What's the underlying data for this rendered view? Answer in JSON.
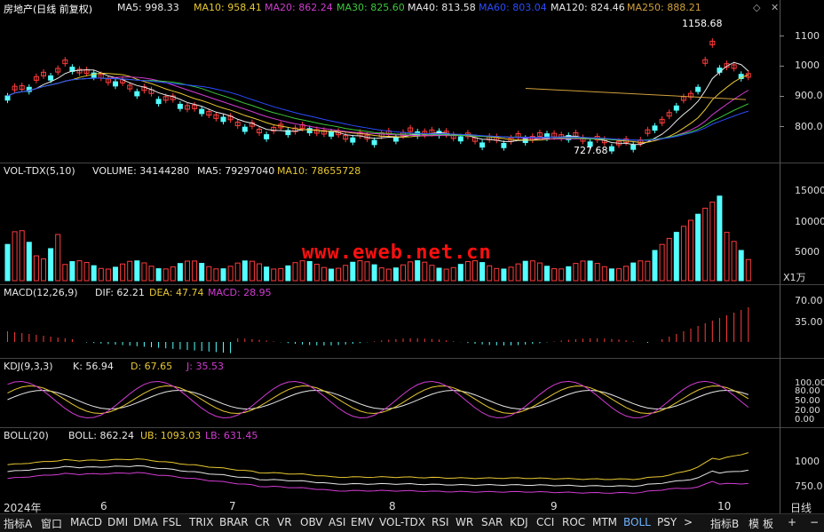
{
  "title": "房地产(日线 前复权)",
  "main": {
    "indicators": [
      {
        "label": "MA5: 998.33",
        "color": "#e8e8e8"
      },
      {
        "label": "MA10: 958.41",
        "color": "#e8c832"
      },
      {
        "label": "MA20: 862.24",
        "color": "#d23cd2"
      },
      {
        "label": "MA30: 825.60",
        "color": "#3cc83c"
      },
      {
        "label": "MA40: 813.58",
        "color": "#e8e8e8"
      },
      {
        "label": "MA60: 803.04",
        "color": "#2a4cff"
      },
      {
        "label": "MA120: 824.46",
        "color": "#e8e8e8"
      },
      {
        "label": "MA250: 888.21",
        "color": "#d2a03c"
      }
    ],
    "high_label": "1158.68",
    "low_label": "727.68",
    "axis": [
      "1100",
      "1000",
      "900.0",
      "800.0"
    ]
  },
  "volume": {
    "header": [
      {
        "label": "VOL-TDX(5,10)",
        "color": "#e8e8e8"
      },
      {
        "label": "VOLUME: 34144280",
        "color": "#e8e8e8"
      },
      {
        "label": "MA5: 79297040",
        "color": "#e8e8e8"
      },
      {
        "label": "MA10: 78655728",
        "color": "#e8c832"
      }
    ],
    "axis": [
      "15000",
      "10000",
      "5000"
    ],
    "unit": "X1万"
  },
  "macd": {
    "header": [
      {
        "label": "MACD(12,26,9)",
        "color": "#e8e8e8"
      },
      {
        "label": "DIF: 62.21",
        "color": "#e8e8e8"
      },
      {
        "label": "DEA: 47.74",
        "color": "#e8c832"
      },
      {
        "label": "MACD: 28.95",
        "color": "#d23cd2"
      }
    ],
    "axis": [
      "70.00",
      "35.00"
    ]
  },
  "kdj": {
    "header": [
      {
        "label": "KDJ(9,3,3)",
        "color": "#e8e8e8"
      },
      {
        "label": "K: 56.94",
        "color": "#e8e8e8"
      },
      {
        "label": "D: 67.65",
        "color": "#e8c832"
      },
      {
        "label": "J: 35.53",
        "color": "#d23cd2"
      }
    ],
    "axis": [
      "100.00",
      "80.00",
      "50.00",
      "20.00",
      "0.00"
    ]
  },
  "boll": {
    "header": [
      {
        "label": "BOLL(20)",
        "color": "#e8e8e8"
      },
      {
        "label": "BOLL: 862.24",
        "color": "#e8e8e8"
      },
      {
        "label": "UB: 1093.03",
        "color": "#e8c832"
      },
      {
        "label": "LB: 631.45",
        "color": "#d23cd2"
      }
    ],
    "axis": [
      "1000",
      "750.0"
    ]
  },
  "x_dates": [
    "2024年",
    "6",
    "7",
    "8",
    "9",
    "10"
  ],
  "period": "日线",
  "watermark": "www.eweb.net.cn",
  "tabs": [
    "指标A",
    "窗口",
    "MACD",
    "DMI",
    "DMA",
    "FSL",
    "TRIX",
    "BRAR",
    "CR",
    "VR",
    "OBV",
    "ASI",
    "EMV",
    "VOL-TDX",
    "RSI",
    "WR",
    "SAR",
    "KDJ",
    "CCI",
    "ROC",
    "MTM",
    "BOLL",
    "PSY",
    ">",
    "指标B",
    "模",
    "板",
    "+",
    "−"
  ],
  "active_tab": "BOLL",
  "colors": {
    "up": "#ff3c3c",
    "down": "#54ffff",
    "bg": "#000000"
  },
  "icons": {
    "settings": "diamond-icon",
    "close": "close-icon"
  }
}
